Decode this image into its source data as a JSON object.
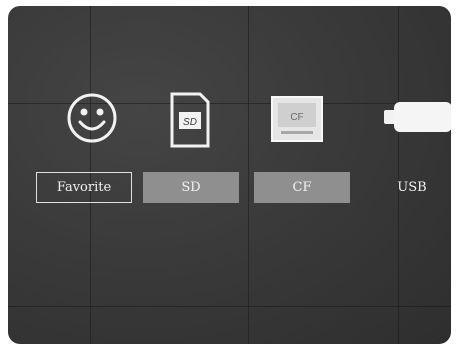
{
  "media_menu": {
    "items": [
      {
        "label": "Favorite",
        "icon": "smiley-icon",
        "selected": true
      },
      {
        "label": "SD",
        "icon": "sd-card-icon",
        "selected": false
      },
      {
        "label": "CF",
        "icon": "cf-card-icon",
        "selected": false
      },
      {
        "label": "USB",
        "icon": "usb-drive-icon",
        "selected": false
      }
    ],
    "sd_icon_text": "SD",
    "cf_icon_text": "CF"
  },
  "colors": {
    "background": "#3a3a3a",
    "tile_gray": "#8f8f8f",
    "text": "#f2f2f2",
    "focus_border": "#e0e0e0"
  }
}
